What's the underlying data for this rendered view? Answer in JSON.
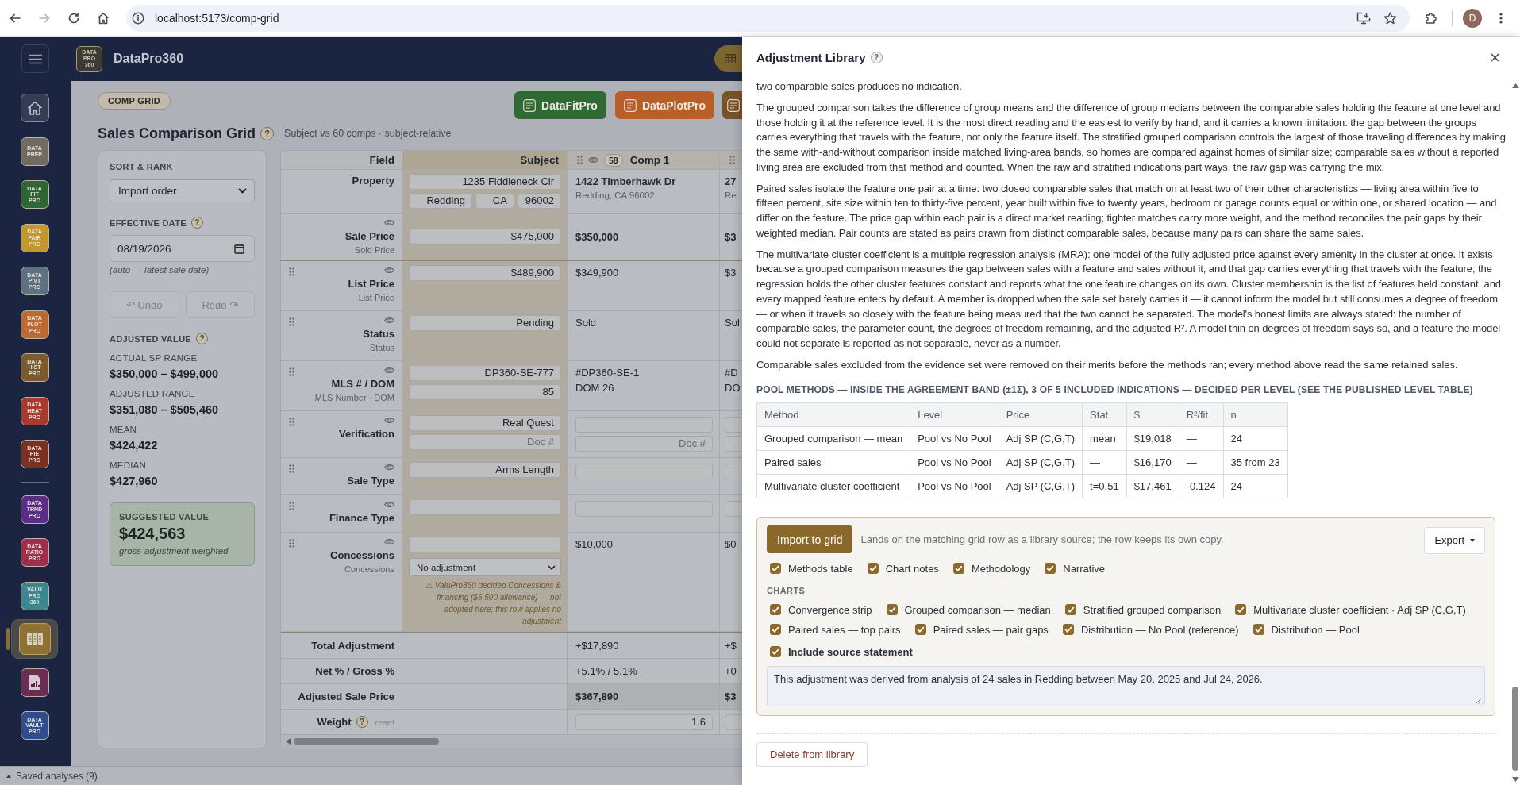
{
  "browser": {
    "url": "localhost:5173/comp-grid",
    "forward_disabled": true,
    "profile": "D"
  },
  "app_bar": {
    "logo": [
      "DATA",
      "PRO",
      "360"
    ],
    "brand": "DataPro360"
  },
  "sidebar": {
    "groups": [
      {
        "items": [
          {
            "kind": "home",
            "color": "#343d55",
            "selected": false
          },
          {
            "kind": "logo",
            "lines": [
              "DATA",
              "PREP"
            ],
            "color": "#6f6b62",
            "selected": false
          },
          {
            "kind": "logo",
            "lines": [
              "DATA",
              "FIT",
              "PRO"
            ],
            "color": "#2d6535",
            "selected": false
          },
          {
            "kind": "logo",
            "lines": [
              "DATA",
              "PAIR",
              "PRO"
            ],
            "color": "#c2972c",
            "selected": false
          },
          {
            "kind": "logo",
            "lines": [
              "DATA",
              "PIVT",
              "PRO"
            ],
            "color": "#5d7183",
            "selected": false
          },
          {
            "kind": "logo",
            "lines": [
              "DATA",
              "PLOT",
              "PRO"
            ],
            "color": "#bd6a32",
            "selected": false
          },
          {
            "kind": "logo",
            "lines": [
              "DATA",
              "HIST",
              "PRO"
            ],
            "color": "#7b5a2f",
            "selected": false
          },
          {
            "kind": "logo",
            "lines": [
              "DATA",
              "HEAT",
              "PRO"
            ],
            "color": "#a63a2e",
            "selected": false
          },
          {
            "kind": "logo",
            "lines": [
              "DATA",
              "PIE",
              "PRO"
            ],
            "color": "#7a3123",
            "selected": false
          }
        ]
      },
      {
        "items": [
          {
            "kind": "logo",
            "lines": [
              "DATA",
              "TRND",
              "PRO"
            ],
            "color": "#5a2d86",
            "selected": false
          },
          {
            "kind": "logo",
            "lines": [
              "DATA",
              "RATIO",
              "PRO"
            ],
            "color": "#9e2f4c",
            "selected": false
          },
          {
            "kind": "logo",
            "lines": [
              "VALU",
              "PRO",
              "360"
            ],
            "color": "#3b8790",
            "selected": false
          },
          {
            "kind": "grid",
            "color": "#8e7133",
            "selected": true
          },
          {
            "kind": "report",
            "color": "#6a2d54",
            "selected": false
          },
          {
            "kind": "logo",
            "lines": [
              "DATA",
              "VAULT",
              "PRO"
            ],
            "color": "#2f4d8c",
            "selected": false
          }
        ]
      }
    ]
  },
  "saved_bar": {
    "label": "Saved analyses (9)"
  },
  "page": {
    "tag": "COMP GRID",
    "title": "Sales Comparison Grid",
    "help": "?",
    "subtitle": "Subject vs 60 comps · subject-relative",
    "app_buttons": [
      {
        "label": "DataFitPro",
        "color": "#2f6a35"
      },
      {
        "label": "DataPlotPro",
        "color": "#b85f27"
      },
      {
        "color": "#7a5228"
      }
    ]
  },
  "controls": {
    "sort": {
      "label": "SORT & RANK",
      "value": "Import order"
    },
    "date": {
      "label": "EFFECTIVE DATE",
      "help": "?",
      "value": "08/19/2026",
      "hint": "(auto — latest sale date)"
    },
    "history": [
      {
        "label": "↶ Undo",
        "disabled": true
      },
      {
        "label": "Redo ↷",
        "disabled": true
      }
    ],
    "adjusted": {
      "title": "ADJUSTED VALUE",
      "help": "?",
      "stats": [
        {
          "label": "ACTUAL SP RANGE",
          "value": "$350,000 – $499,000"
        },
        {
          "label": "ADJUSTED RANGE",
          "value": "$351,080 – $505,460"
        },
        {
          "label": "MEAN",
          "value": "$424,422"
        },
        {
          "label": "MEDIAN",
          "value": "$427,960"
        }
      ]
    },
    "suggested": {
      "label": "SUGGESTED VALUE",
      "value": "$424,563",
      "note": "gross-adjustment weighted"
    }
  },
  "grid": {
    "headers": {
      "field": "Field",
      "subject": "Subject"
    },
    "comps": [
      {
        "label": "Comp 1",
        "badge": "58",
        "eye": true
      },
      {
        "eye": false
      }
    ],
    "rows": [
      {
        "kind": "property",
        "label": "Property",
        "draggable": false,
        "eye": false,
        "subject": [
          {
            "kind": "input",
            "value": "1235 Fiddleneck Cir"
          },
          {
            "kind": "inputs",
            "values": [
              "Redding",
              "CA",
              "96002"
            ]
          }
        ],
        "comps": [
          [
            {
              "kind": "medium",
              "text": "1422 Timberhawk Dr"
            },
            {
              "kind": "muted",
              "text": "Redding, CA 96002"
            }
          ],
          [
            {
              "kind": "medium",
              "text": "27"
            },
            {
              "kind": "muted",
              "text": "Re"
            }
          ]
        ]
      },
      {
        "kind": "key",
        "label": "Sale Price",
        "sublabel": "Sold Price",
        "draggable": false,
        "eye": true,
        "subject": [
          {
            "kind": "input",
            "value": "$475,000"
          }
        ],
        "comps": [
          [
            {
              "kind": "bold",
              "text": "$350,000"
            }
          ],
          [
            {
              "kind": "bold",
              "text": "$3"
            }
          ]
        ]
      },
      {
        "kind": "field",
        "label": "List Price",
        "sublabel": "List Price",
        "draggable": true,
        "eye": true,
        "subject": [
          {
            "kind": "input",
            "value": "$489,900"
          }
        ],
        "comps": [
          [
            {
              "kind": "plain",
              "text": "$349,900"
            }
          ],
          [
            {
              "kind": "plain",
              "text": "$3"
            }
          ]
        ]
      },
      {
        "kind": "field",
        "label": "Status",
        "sublabel": "Status",
        "draggable": true,
        "eye": true,
        "subject": [
          {
            "kind": "input",
            "value": "Pending"
          }
        ],
        "comps": [
          [
            {
              "kind": "plain",
              "text": "Sold"
            }
          ],
          [
            {
              "kind": "plain",
              "text": "Sol"
            }
          ]
        ]
      },
      {
        "kind": "field",
        "label": "MLS # / DOM",
        "sublabel": "MLS Number · DOM",
        "draggable": true,
        "eye": true,
        "subject": [
          {
            "kind": "input",
            "value": "DP360-SE-777"
          },
          {
            "kind": "input",
            "value": "85"
          }
        ],
        "comps": [
          [
            {
              "kind": "plain",
              "text": "#DP360-SE-1"
            },
            {
              "kind": "plain",
              "text": "DOM 26"
            }
          ],
          [
            {
              "kind": "plain",
              "text": "#D"
            },
            {
              "kind": "plain",
              "text": "DO"
            }
          ]
        ]
      },
      {
        "kind": "field",
        "label": "Verification",
        "draggable": true,
        "eye": true,
        "subject": [
          {
            "kind": "input",
            "value": "Real Quest"
          },
          {
            "kind": "input",
            "placeholder": "Doc #"
          }
        ],
        "comps": [
          [
            {
              "kind": "input"
            },
            {
              "kind": "input",
              "placeholder": "Doc #"
            }
          ],
          [
            {
              "kind": "input"
            },
            {
              "kind": "input"
            }
          ]
        ]
      },
      {
        "kind": "field",
        "label": "Sale Type",
        "draggable": true,
        "eye": true,
        "subject": [
          {
            "kind": "input",
            "value": "Arms Length"
          }
        ],
        "comps": [
          [
            {
              "kind": "input"
            }
          ],
          [
            {
              "kind": "input"
            }
          ]
        ]
      },
      {
        "kind": "field",
        "label": "Finance Type",
        "draggable": true,
        "eye": true,
        "subject": [
          {
            "kind": "input"
          }
        ],
        "comps": [
          [
            {
              "kind": "input"
            }
          ],
          [
            {
              "kind": "input"
            }
          ]
        ]
      },
      {
        "kind": "field",
        "label": "Concessions",
        "sublabel": "Concessions",
        "draggable": true,
        "eye": true,
        "subject": [
          {
            "kind": "input"
          },
          {
            "kind": "select",
            "value": "No adjustment"
          },
          {
            "kind": "note",
            "text": "⚠ ValuPro360 decided Concessions & financing ($5,500 allowance) — not adopted here; this row applies no adjustment"
          }
        ],
        "comps": [
          [
            {
              "kind": "plain",
              "text": "$10,000"
            }
          ],
          [
            {
              "kind": "plain",
              "text": "$0"
            }
          ]
        ]
      }
    ],
    "summary": [
      {
        "label": "Total Adjustment",
        "highlight": false,
        "comps": [
          {
            "kind": "plain",
            "text": "+$17,890"
          },
          {
            "kind": "plain",
            "text": "+$"
          }
        ]
      },
      {
        "label": "Net % / Gross %",
        "highlight": false,
        "comps": [
          {
            "kind": "plain",
            "text": "+5.1% / 5.1%"
          },
          {
            "kind": "plain",
            "text": "+0"
          }
        ]
      },
      {
        "label": "Adjusted Sale Price",
        "highlight": true,
        "comps": [
          {
            "kind": "bold",
            "text": "$367,890"
          },
          {
            "kind": "bold",
            "text": "$3"
          }
        ]
      },
      {
        "label": "Weight",
        "help": "?",
        "reset": "reset",
        "highlight": false,
        "comps": [
          {
            "kind": "input",
            "value": "1.6"
          },
          {
            "kind": "input"
          }
        ]
      }
    ]
  },
  "drawer": {
    "title": "Adjustment Library",
    "help": "?",
    "paragraphs": [
      "two comparable sales produces no indication.",
      "The grouped comparison takes the difference of group means and the difference of group medians between the comparable sales holding the feature at one level and those holding it at the reference level. It is the most direct reading and the easiest to verify by hand, and it carries a known limitation: the gap between the groups carries everything that travels with the feature, not only the feature itself. The stratified grouped comparison controls the largest of those traveling differences by making the same with-and-without comparison inside matched living-area bands, so homes are compared against homes of similar size; comparable sales without a reported living area are excluded from that method and counted. When the raw and stratified indications part ways, the raw gap was carrying the mix.",
      "Paired sales isolate the feature one pair at a time: two closed comparable sales that match on at least two of their other characteristics — living area within five to fifteen percent, site size within ten to thirty-five percent, year built within five to twenty years, bedroom or garage counts equal or within one, or shared location — and differ on the feature. The price gap within each pair is a direct market reading; tighter matches carry more weight, and the method reconciles the pair gaps by their weighted median. Pair counts are stated as pairs drawn from distinct comparable sales, because many pairs can share the same sales.",
      "The multivariate cluster coefficient is a multiple regression analysis (MRA): one model of the fully adjusted price against every amenity in the cluster at once. It exists because a grouped comparison measures the gap between sales with a feature and sales without it, and that gap carries everything that travels with the feature; the regression holds the other cluster features constant and reports what the one feature changes on its own. Cluster membership is the list of features held constant, and every mapped feature enters by default. A member is dropped when the sale set barely carries it — it cannot inform the model but still consumes a degree of freedom — or when it travels so closely with the feature being measured that the two cannot be separated. The model's honest limits are always stated: the number of comparable sales, the parameter count, the degrees of freedom remaining, and the adjusted R². A model thin on degrees of freedom says so, and a feature the model could not separate is reported as not separable, never as a number.",
      "Comparable sales excluded from the evidence set were removed on their merits before the methods ran; every method above read the same retained sales."
    ],
    "pool_heading": "POOL METHODS — INSIDE THE AGREEMENT BAND (±1Σ), 3 OF 5 INCLUDED INDICATIONS — DECIDED PER LEVEL (SEE THE PUBLISHED LEVEL TABLE)",
    "methods_table": {
      "columns": [
        "Method",
        "Level",
        "Price",
        "Stat",
        "$",
        "R²/fit",
        "n"
      ],
      "rows": [
        [
          "Grouped comparison — mean",
          "Pool vs No Pool",
          "Adj SP (C,G,T)",
          "mean",
          "$19,018",
          "—",
          "24"
        ],
        [
          "Paired sales",
          "Pool vs No Pool",
          "Adj SP (C,G,T)",
          "—",
          "$16,170",
          "—",
          "35 from 23"
        ],
        [
          "Multivariate cluster coefficient",
          "Pool vs No Pool",
          "Adj SP (C,G,T)",
          "t=0.51",
          "$17,461",
          "-0.124",
          "24"
        ]
      ]
    },
    "import": {
      "button": "Import to grid",
      "hint": "Lands on the matching grid row as a library source; the row keeps its own copy.",
      "export": "Export",
      "sections": [
        {
          "label": "Methods table",
          "checked": true
        },
        {
          "label": "Chart notes",
          "checked": true
        },
        {
          "label": "Methodology",
          "checked": true
        },
        {
          "label": "Narrative",
          "checked": true
        }
      ],
      "charts_heading": "CHARTS",
      "charts": [
        {
          "label": "Convergence strip",
          "checked": true
        },
        {
          "label": "Grouped comparison — median",
          "checked": true
        },
        {
          "label": "Stratified grouped comparison",
          "checked": true
        },
        {
          "label": "Multivariate cluster coefficient · Adj SP (C,G,T)",
          "checked": true
        },
        {
          "label": "Paired sales — top pairs",
          "checked": true
        },
        {
          "label": "Paired sales — pair gaps",
          "checked": true
        },
        {
          "label": "Distribution — No Pool (reference)",
          "checked": true
        },
        {
          "label": "Distribution — Pool",
          "checked": true
        }
      ],
      "source": {
        "label": "Include source statement",
        "checked": true,
        "text": "This adjustment was derived from analysis of 24 sales in Redding between May 20, 2025 and Jul 24, 2026."
      }
    },
    "delete_button": "Delete from library"
  }
}
